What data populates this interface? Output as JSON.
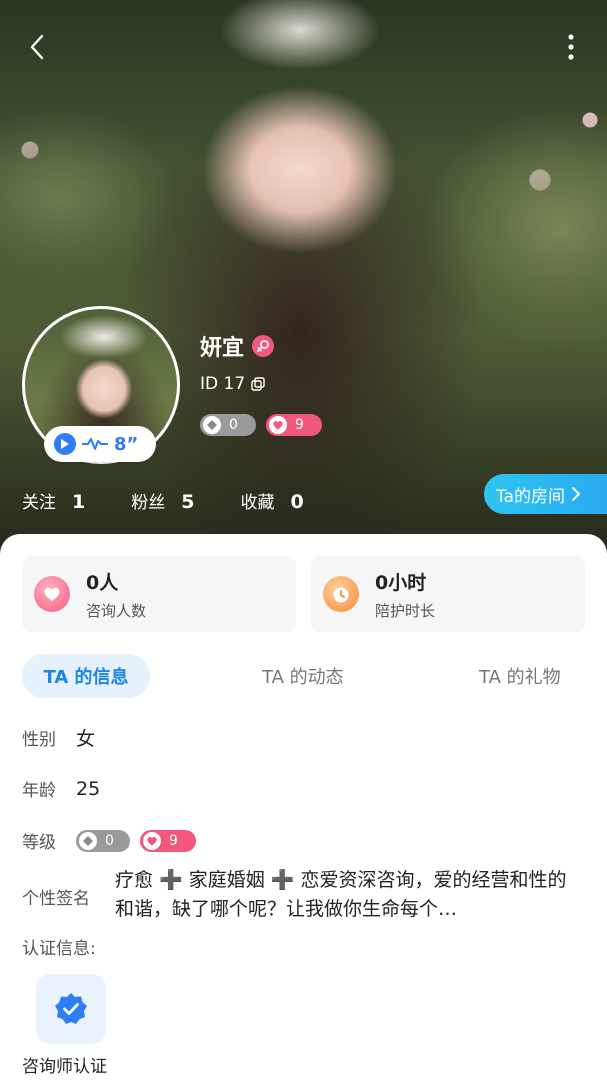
{
  "profile": {
    "name": "妍宜",
    "id_text": "ID 17",
    "voice_duration": "8”",
    "level_grey": "0",
    "level_pink": "9"
  },
  "stats": [
    {
      "label": "关注",
      "value": "1"
    },
    {
      "label": "粉丝",
      "value": "5"
    },
    {
      "label": "收藏",
      "value": "0"
    }
  ],
  "room_button": {
    "label": "Ta的房间"
  },
  "metrics": [
    {
      "value": "0人",
      "label": "咨询人数"
    },
    {
      "value": "0小时",
      "label": "陪护时长"
    }
  ],
  "tabs": [
    {
      "label": "TA 的信息",
      "active": true
    },
    {
      "label": "TA 的动态",
      "active": false
    },
    {
      "label": "TA 的礼物",
      "active": false
    }
  ],
  "info": {
    "gender_label": "性别",
    "gender_value": "女",
    "age_label": "年龄",
    "age_value": "25",
    "level_label": "等级",
    "signature_label": "个性签名",
    "signature_text": "疗愈 ➕ 家庭婚姻 ➕ 恋爱资深咨询，爱的经营和性的和谐，缺了哪个呢？让我做你生命每个…"
  },
  "certification": {
    "title": "认证信息:",
    "item_label": "咨询师认证"
  },
  "colors": {
    "accent_blue": "#1f86e6",
    "room_button": "#2ec5f0",
    "pink_badge": "#f2577d",
    "grey_badge": "#9a9a9a"
  },
  "icons": [
    "back-arrow-icon",
    "more-vertical-icon",
    "play-icon",
    "waveform-icon",
    "female-icon",
    "copy-icon",
    "diamond-icon",
    "heart-icon",
    "chevron-right-icon",
    "certified-badge-icon",
    "alarm-clock-icon"
  ]
}
